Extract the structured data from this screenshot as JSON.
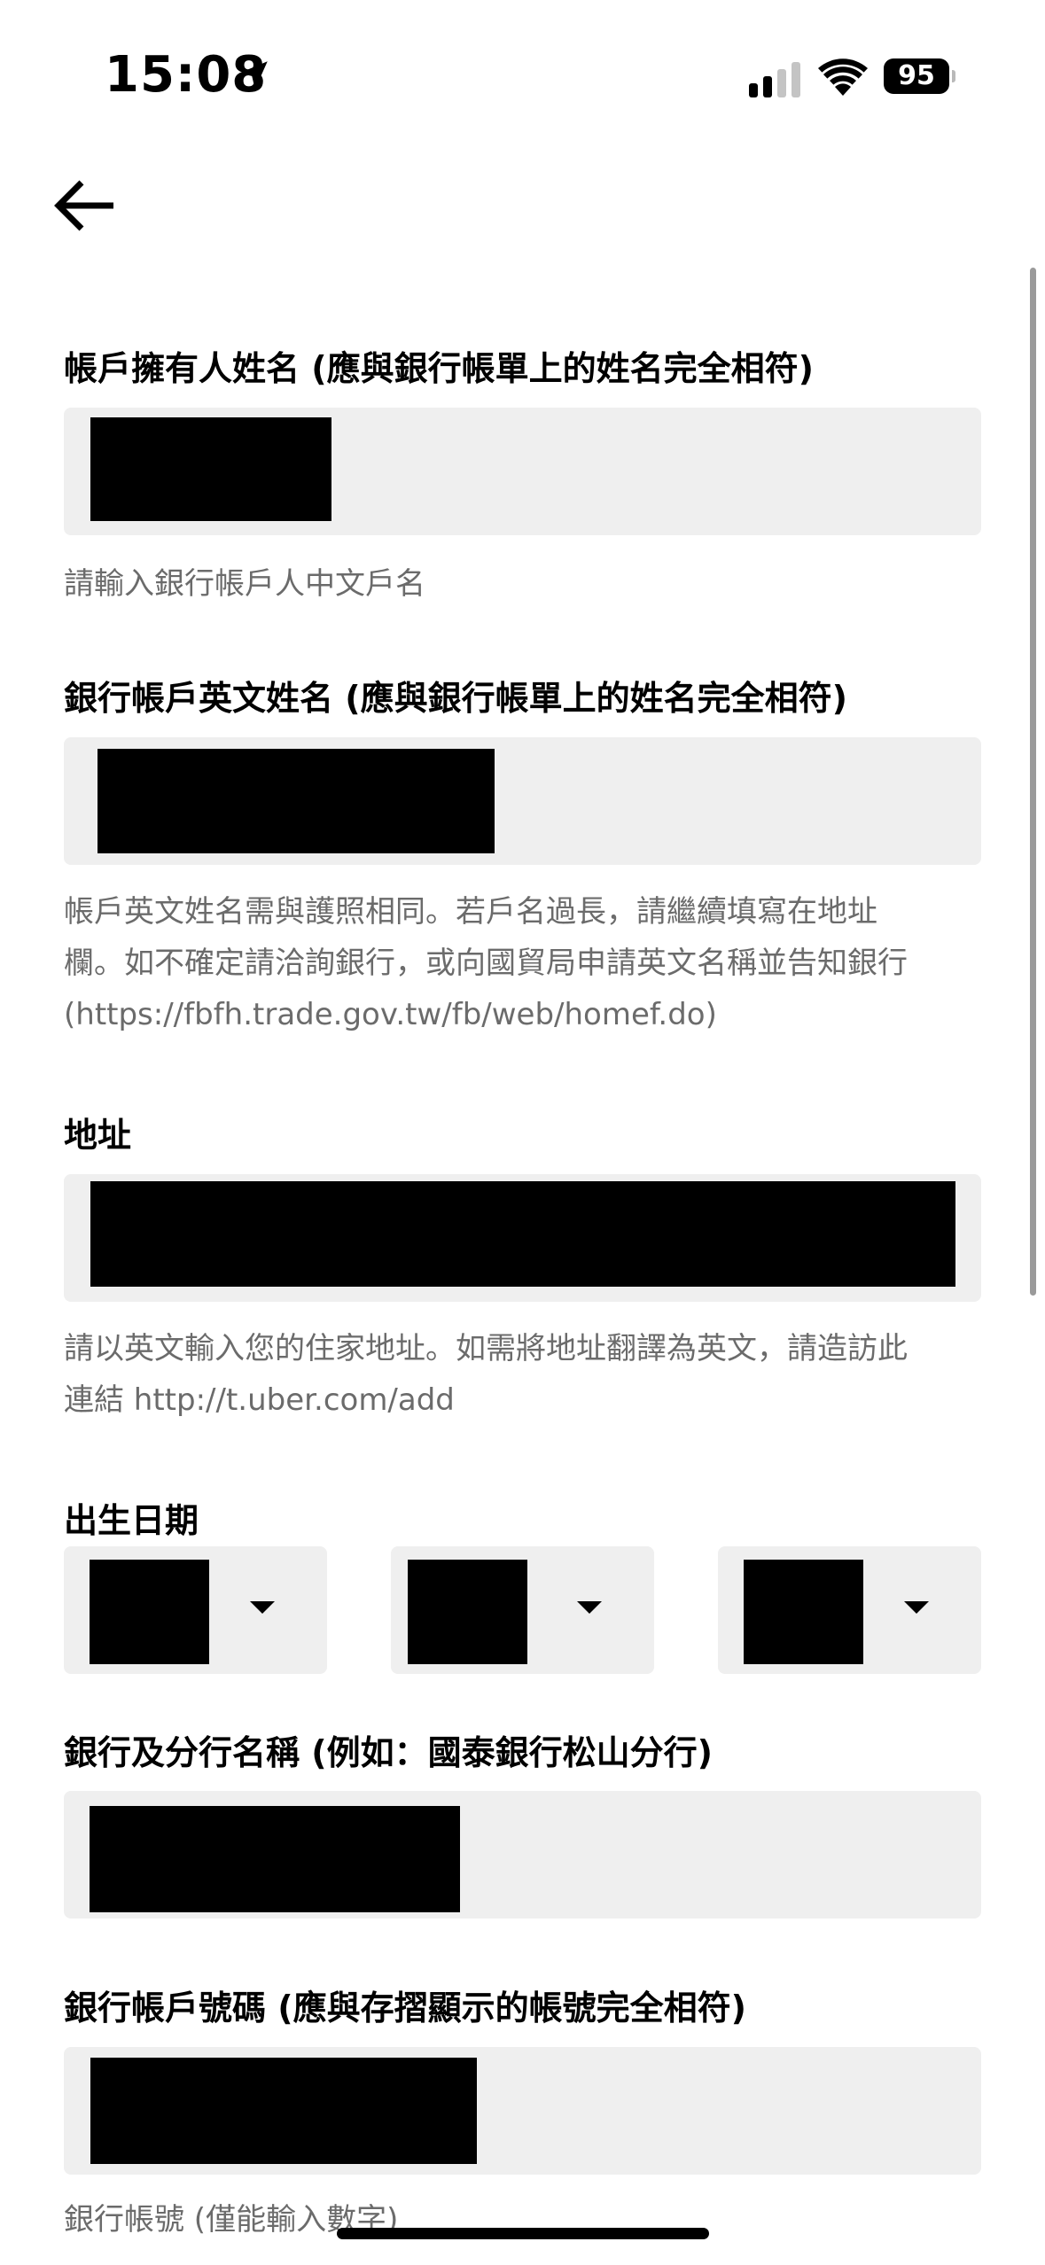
{
  "status_bar": {
    "time": "15:08",
    "battery": "95",
    "icons": [
      "location-arrow-icon",
      "cellular-signal-icon",
      "wifi-icon",
      "battery-icon"
    ]
  },
  "navigation": {
    "back_icon": "arrow-left-icon"
  },
  "form": {
    "holder_name": {
      "label": "帳戶擁有人姓名 (應與銀行帳單上的姓名完全相符)",
      "hint": "請輸入銀行帳戶人中文戶名"
    },
    "english_name": {
      "label": "銀行帳戶英文姓名 (應與銀行帳單上的姓名完全相符)",
      "hint_lines": [
        "帳戶英文姓名需與護照相同。若戶名過長，請繼續填寫在地址",
        "欄。如不確定請洽詢銀行，或向國貿局申請英文名稱並告知銀行",
        "(https://fbfh.trade.gov.tw/fb/web/homef.do)"
      ]
    },
    "address": {
      "label": "地址",
      "hint_lines": [
        "請以英文輸入您的住家地址。如需將地址翻譯為英文，請造訪此",
        "連結 http://t.uber.com/add"
      ]
    },
    "birth_date": {
      "label": "出生日期",
      "dropdown_icon": "chevron-down-icon"
    },
    "bank_branch": {
      "label": "銀行及分行名稱 (例如：國泰銀行松山分行)"
    },
    "account_number": {
      "label": "銀行帳戶號碼 (應與存摺顯示的帳號完全相符)",
      "hint": "銀行帳號 (僅能輸入數字)"
    }
  },
  "colors": {
    "field_background": "#efefef",
    "hint_text": "#6b6b6b",
    "redaction": "#000000"
  }
}
